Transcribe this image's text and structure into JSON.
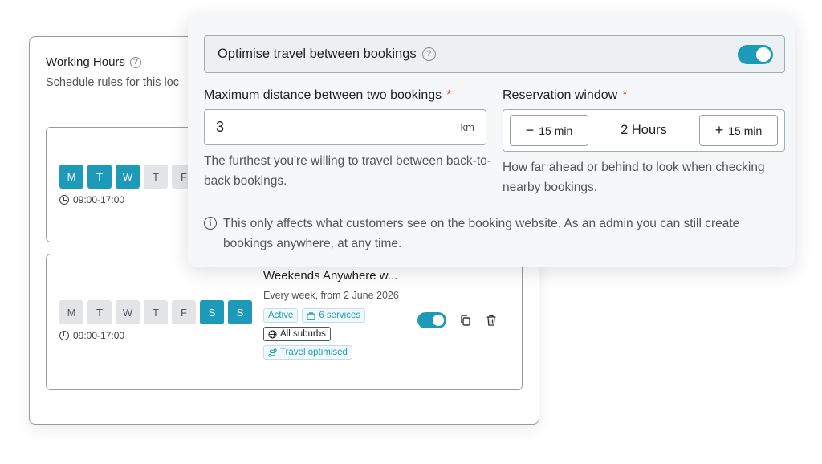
{
  "working_hours": {
    "title": "Working Hours",
    "subtitle": "Schedule rules for this loc",
    "rules": [
      {
        "days": [
          {
            "label": "M",
            "active": true
          },
          {
            "label": "T",
            "active": true
          },
          {
            "label": "W",
            "active": true
          },
          {
            "label": "T",
            "active": false
          },
          {
            "label": "F",
            "active": false
          }
        ],
        "time": "09:00-17:00"
      },
      {
        "days": [
          {
            "label": "M",
            "active": false
          },
          {
            "label": "T",
            "active": false
          },
          {
            "label": "W",
            "active": false
          },
          {
            "label": "T",
            "active": false
          },
          {
            "label": "F",
            "active": false
          },
          {
            "label": "S",
            "active": true
          },
          {
            "label": "S",
            "active": true
          }
        ],
        "time": "09:00-17:00",
        "title": "Weekends Anywhere w...",
        "schedule": "Every week, from 2 June 2026",
        "tags": {
          "status": "Active",
          "services": "6 services",
          "area": "All suburbs",
          "travel": "Travel optimised"
        },
        "enabled": true
      }
    ]
  },
  "travel": {
    "toggle_label": "Optimise travel between bookings",
    "toggle_on": true,
    "max_distance": {
      "label": "Maximum distance between two bookings",
      "required_mark": "*",
      "value": "3",
      "unit": "km",
      "help": "The furthest you're willing to travel between back-to-back bookings."
    },
    "reservation_window": {
      "label": "Reservation window",
      "required_mark": "*",
      "decrement_label": "15 min",
      "value": "2 Hours",
      "increment_label": "15 min",
      "help": "How far ahead or behind to look when checking nearby bookings."
    },
    "note": "This only affects what customers see on the booking website. As an admin you can still create bookings anywhere, at any time."
  },
  "colors": {
    "accent": "#1e9ab9",
    "required": "#e23b3b"
  }
}
